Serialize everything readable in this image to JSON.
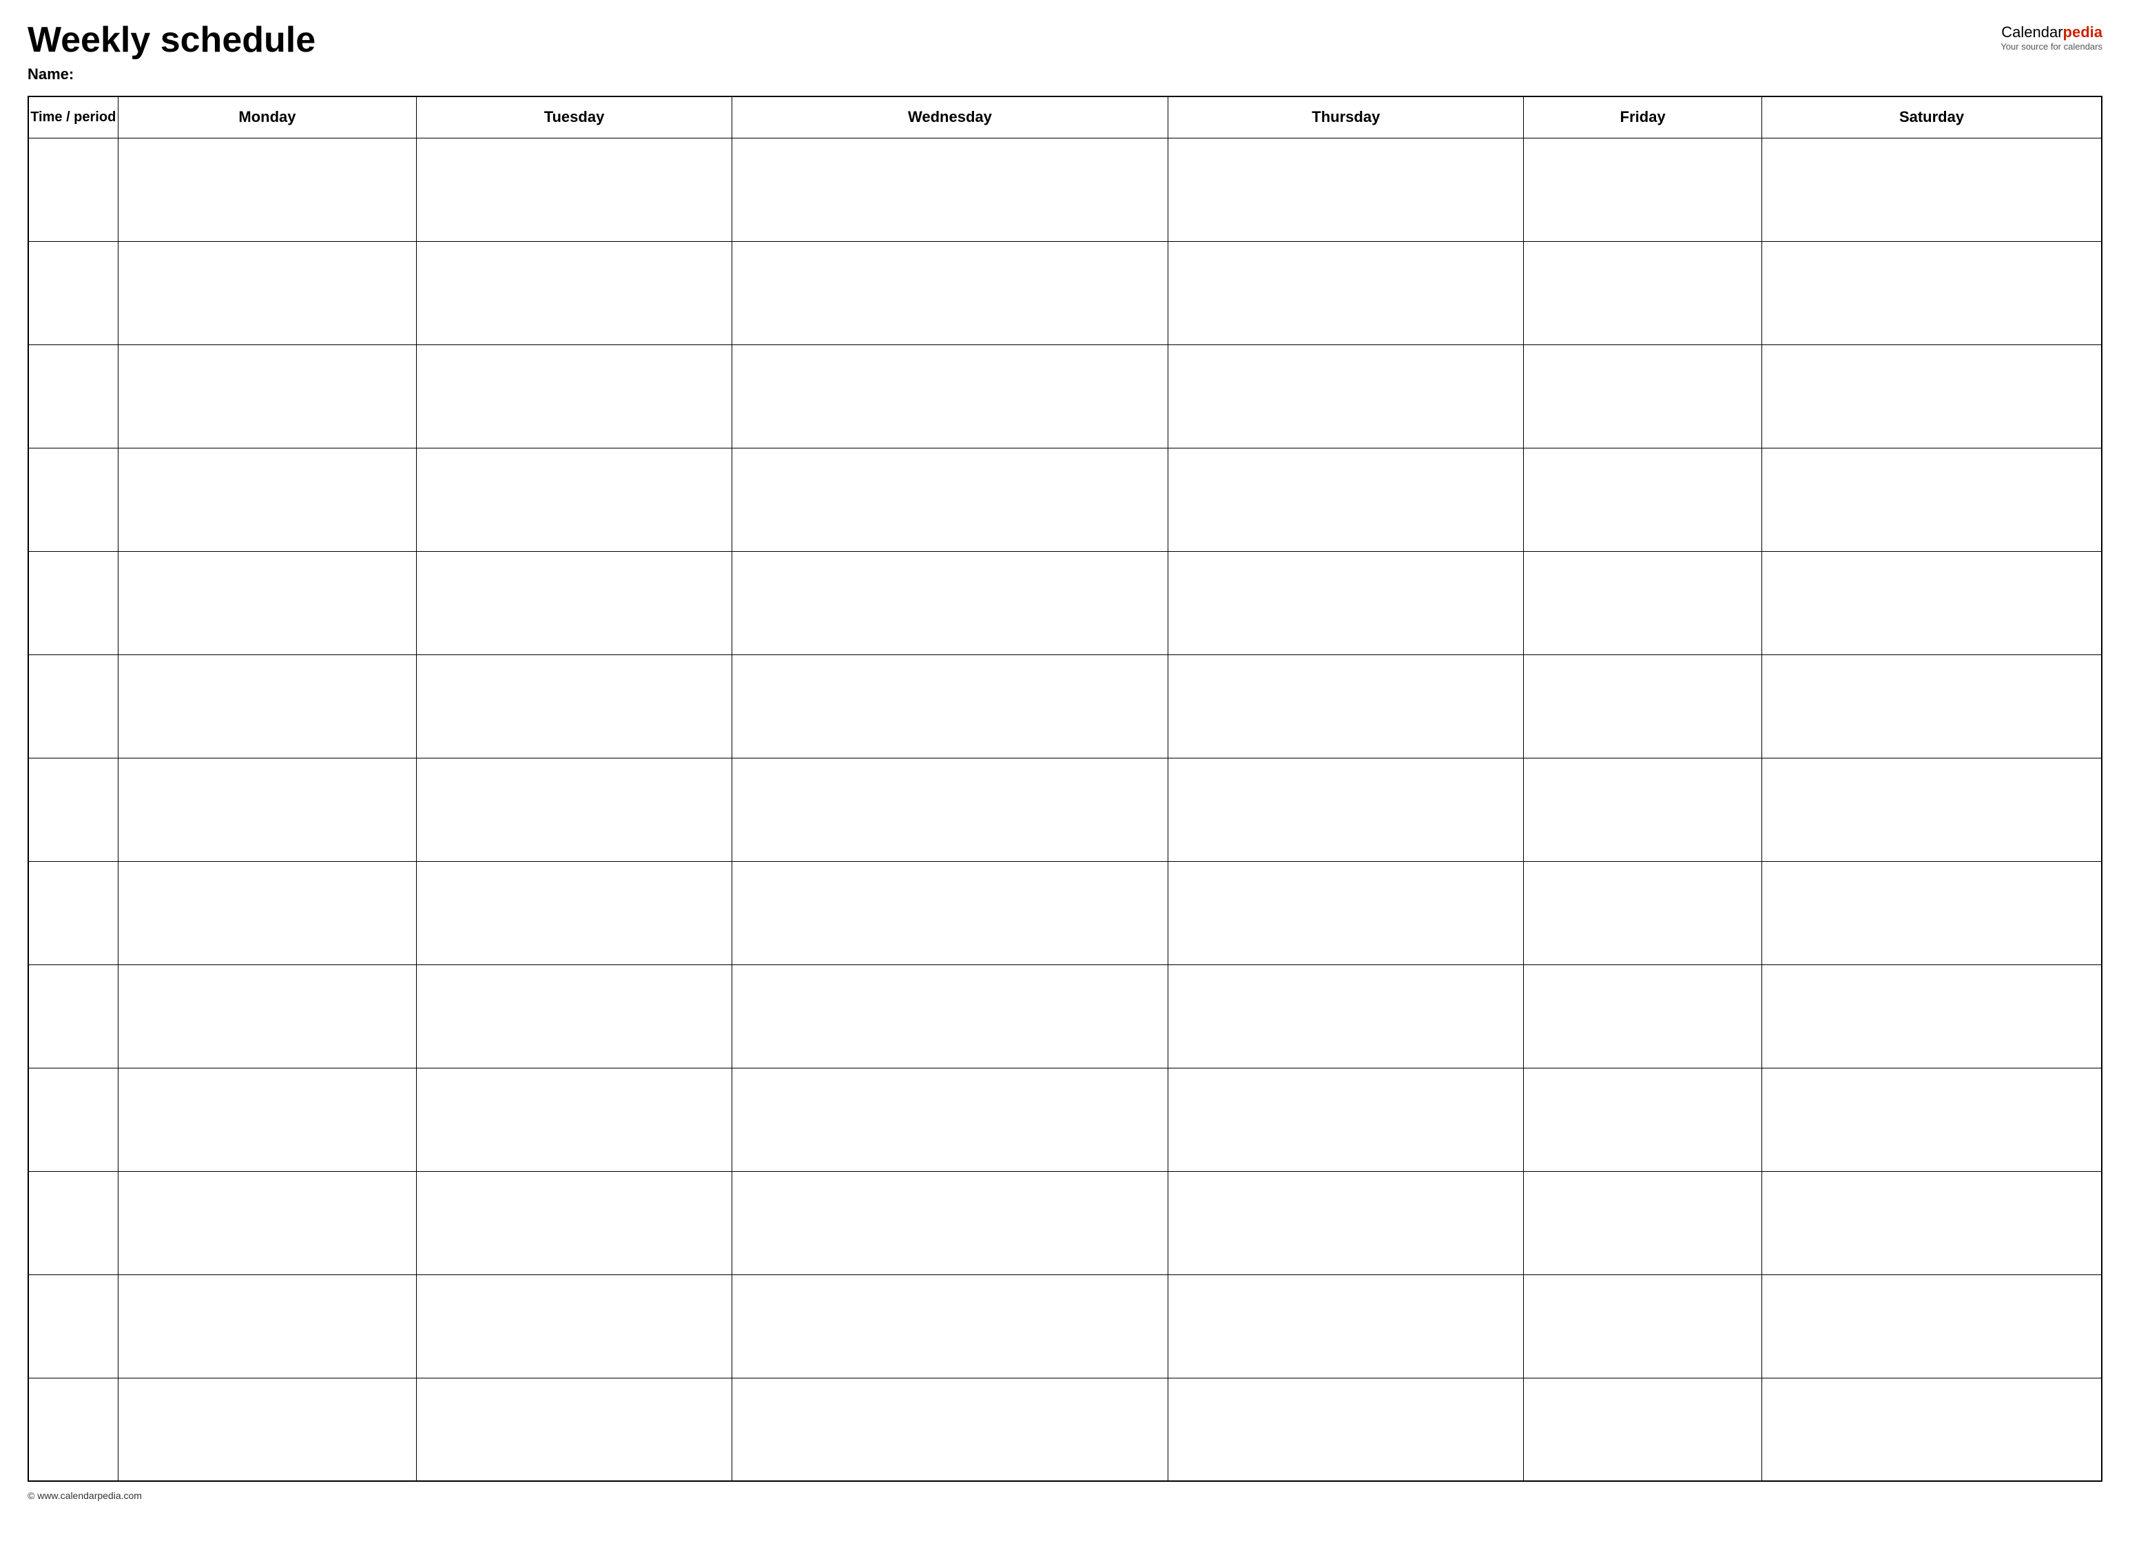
{
  "header": {
    "title": "Weekly schedule",
    "name_label": "Name:",
    "logo_calendar": "Calendar",
    "logo_pedia": "pedia",
    "logo_sub": "Your source for calendars"
  },
  "table": {
    "columns": [
      {
        "id": "time",
        "label": "Time / period"
      },
      {
        "id": "monday",
        "label": "Monday"
      },
      {
        "id": "tuesday",
        "label": "Tuesday"
      },
      {
        "id": "wednesday",
        "label": "Wednesday"
      },
      {
        "id": "thursday",
        "label": "Thursday"
      },
      {
        "id": "friday",
        "label": "Friday"
      },
      {
        "id": "saturday",
        "label": "Saturday"
      }
    ],
    "row_count": 13
  },
  "footer": {
    "url": "© www.calendarpedia.com"
  }
}
